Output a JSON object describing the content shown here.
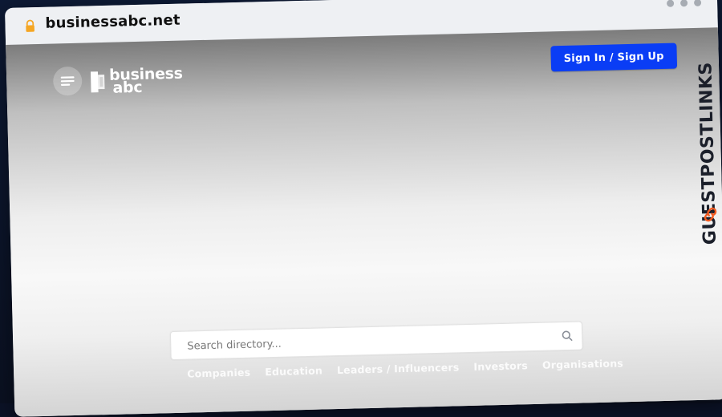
{
  "browser": {
    "url": "businessabc.net"
  },
  "header": {
    "logo_line1": "business",
    "logo_line2": "abc",
    "signin_label": "Sign In / Sign Up"
  },
  "search": {
    "placeholder": "Search directory..."
  },
  "categories": [
    "Companies",
    "Education",
    "Leaders / Influencers",
    "Investors",
    "Organisations"
  ],
  "side_brand": {
    "text": "GUESTPOSTLINKS"
  },
  "colors": {
    "signin_bg": "#0a3df5",
    "lock": "#f5a623",
    "brand_icon": "#f25a1f"
  },
  "icons": {
    "lock": "lock-icon",
    "menu": "menu-icon",
    "search": "search-icon",
    "dots": "window-dots-icon",
    "brand": "link-icon"
  }
}
